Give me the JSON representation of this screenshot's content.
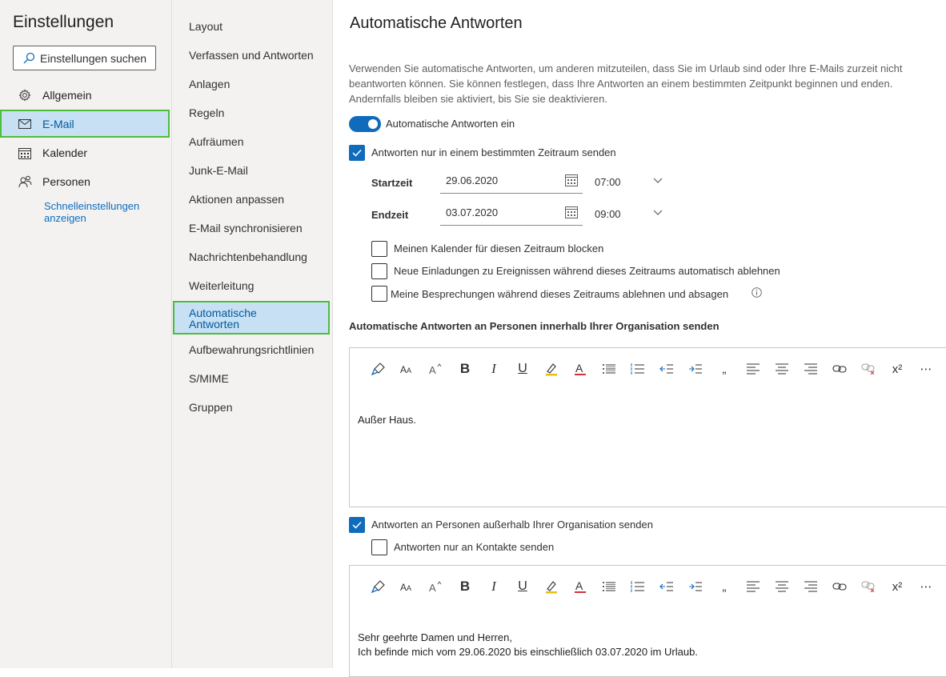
{
  "sidebar": {
    "title": "Einstellungen",
    "search_placeholder": "Einstellungen suchen",
    "items": [
      {
        "label": "Allgemein",
        "icon": "gear-icon"
      },
      {
        "label": "E-Mail",
        "icon": "mail-icon",
        "selected": true
      },
      {
        "label": "Kalender",
        "icon": "calendar-icon"
      },
      {
        "label": "Personen",
        "icon": "people-icon"
      }
    ],
    "quick_settings_link": "Schnelleinstellungen anzeigen"
  },
  "mail_nav": {
    "items": [
      "Layout",
      "Verfassen und Antworten",
      "Anlagen",
      "Regeln",
      "Aufräumen",
      "Junk-E-Mail",
      "Aktionen anpassen",
      "E-Mail synchronisieren",
      "Nachrichtenbehandlung",
      "Weiterleitung",
      "Automatische Antworten",
      "Aufbewahrungsrichtlinien",
      "S/MIME",
      "Gruppen"
    ],
    "selected": "Automatische Antworten"
  },
  "main": {
    "title": "Automatische Antworten",
    "description": "Verwenden Sie automatische Antworten, um anderen mitzuteilen, dass Sie im Urlaub sind oder Ihre E-Mails zurzeit nicht beantworten können. Sie können festlegen, dass Ihre Antworten an einem bestimmten Zeitpunkt beginnen und enden. Andernfalls bleiben sie aktiviert, bis Sie sie deaktivieren.",
    "toggle_label": "Automatische Antworten ein",
    "toggle_on": true,
    "time_range_label": "Antworten nur in einem bestimmten Zeitraum senden",
    "time_range_checked": true,
    "start_label": "Startzeit",
    "start_date": "29.06.2020",
    "start_time": "07:00",
    "end_label": "Endzeit",
    "end_date": "03.07.2020",
    "end_time": "09:00",
    "option_block_calendar": "Meinen Kalender für diesen Zeitraum blocken",
    "option_decline_invites": "Neue Einladungen zu Ereignissen während dieses Zeitraums automatisch ablehnen",
    "option_decline_meetings": "Meine Besprechungen während dieses Zeitraums ablehnen und absagen",
    "inside_org_heading": "Automatische Antworten an Personen innerhalb Ihrer Organisation senden",
    "inside_org_message": "Außer Haus.",
    "outside_org_label": "Antworten an Personen außerhalb Ihrer Organisation senden",
    "outside_org_checked": true,
    "contacts_only_label": "Antworten nur an Kontakte senden",
    "outside_message_line1": "Sehr geehrte Damen und Herren,",
    "outside_message_line2": "Ich befinde mich vom 29.06.2020 bis einschließlich 03.07.2020 im Urlaub."
  },
  "toolbar": {
    "bold": "B",
    "italic": "I",
    "underline": "U",
    "quote": "„",
    "superscript": "x²",
    "more": "⋯"
  },
  "colors": {
    "accent": "#0f6cbd",
    "selection_bg": "#c7e0f4",
    "highlight_border": "#4fbd3c",
    "pane_bg": "#f3f2f1"
  }
}
